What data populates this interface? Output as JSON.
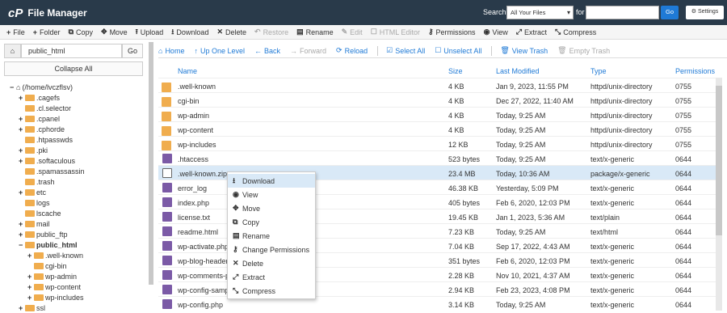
{
  "topbar": {
    "logo": "cP",
    "title": "File Manager",
    "search_label": "Search",
    "search_scope": "All Your Files",
    "for_label": "for",
    "search_value": "",
    "go_label": "Go",
    "settings_label": "Settings"
  },
  "toolbar": [
    {
      "icon": "plus-icon",
      "glyph": "+",
      "label": "File",
      "disabled": false
    },
    {
      "icon": "plus-icon",
      "glyph": "+",
      "label": "Folder",
      "disabled": false
    },
    {
      "icon": "copy-icon",
      "glyph": "⧉",
      "label": "Copy",
      "disabled": false
    },
    {
      "icon": "move-icon",
      "glyph": "✥",
      "label": "Move",
      "disabled": false
    },
    {
      "icon": "upload-icon",
      "glyph": "⭱",
      "label": "Upload",
      "disabled": false
    },
    {
      "icon": "download-icon",
      "glyph": "⭳",
      "label": "Download",
      "disabled": false
    },
    {
      "icon": "delete-icon",
      "glyph": "✕",
      "label": "Delete",
      "disabled": false
    },
    {
      "icon": "restore-icon",
      "glyph": "↶",
      "label": "Restore",
      "disabled": true
    },
    {
      "icon": "rename-icon",
      "glyph": "▤",
      "label": "Rename",
      "disabled": false
    },
    {
      "icon": "edit-icon",
      "glyph": "✎",
      "label": "Edit",
      "disabled": true
    },
    {
      "icon": "html-editor-icon",
      "glyph": "☐",
      "label": "HTML Editor",
      "disabled": true
    },
    {
      "icon": "key-icon",
      "glyph": "⚷",
      "label": "Permissions",
      "disabled": false
    },
    {
      "icon": "eye-icon",
      "glyph": "◉",
      "label": "View",
      "disabled": false
    },
    {
      "icon": "extract-icon",
      "glyph": "⤢",
      "label": "Extract",
      "disabled": false
    },
    {
      "icon": "compress-icon",
      "glyph": "⤡",
      "label": "Compress",
      "disabled": false
    }
  ],
  "sidebar": {
    "path_value": "public_html",
    "go_label": "Go",
    "collapse_label": "Collapse All",
    "tree": [
      {
        "label": "(/home/lvczflsv)",
        "level": 0,
        "toggle": "−",
        "home": true,
        "bold": false
      },
      {
        "label": ".cagefs",
        "level": 1,
        "toggle": "+",
        "bold": false
      },
      {
        "label": ".cl.selector",
        "level": 1,
        "toggle": "",
        "bold": false
      },
      {
        "label": ".cpanel",
        "level": 1,
        "toggle": "+",
        "bold": false
      },
      {
        "label": ".cphorde",
        "level": 1,
        "toggle": "+",
        "bold": false
      },
      {
        "label": ".htpasswds",
        "level": 1,
        "toggle": "",
        "bold": false
      },
      {
        "label": ".pki",
        "level": 1,
        "toggle": "+",
        "bold": false
      },
      {
        "label": ".softaculous",
        "level": 1,
        "toggle": "+",
        "bold": false
      },
      {
        "label": ".spamassassin",
        "level": 1,
        "toggle": "",
        "bold": false
      },
      {
        "label": ".trash",
        "level": 1,
        "toggle": "",
        "bold": false
      },
      {
        "label": "etc",
        "level": 1,
        "toggle": "+",
        "bold": false
      },
      {
        "label": "logs",
        "level": 1,
        "toggle": "",
        "bold": false
      },
      {
        "label": "lscache",
        "level": 1,
        "toggle": "",
        "bold": false
      },
      {
        "label": "mail",
        "level": 1,
        "toggle": "+",
        "bold": false
      },
      {
        "label": "public_ftp",
        "level": 1,
        "toggle": "+",
        "bold": false
      },
      {
        "label": "public_html",
        "level": 1,
        "toggle": "−",
        "bold": true
      },
      {
        "label": ".well-known",
        "level": 2,
        "toggle": "+",
        "bold": false
      },
      {
        "label": "cgi-bin",
        "level": 2,
        "toggle": "",
        "bold": false
      },
      {
        "label": "wp-admin",
        "level": 2,
        "toggle": "+",
        "bold": false
      },
      {
        "label": "wp-content",
        "level": 2,
        "toggle": "+",
        "bold": false
      },
      {
        "label": "wp-includes",
        "level": 2,
        "toggle": "+",
        "bold": false
      },
      {
        "label": "ssl",
        "level": 1,
        "toggle": "+",
        "bold": false
      }
    ]
  },
  "nav": [
    {
      "icon": "home-icon",
      "glyph": "⌂",
      "label": "Home",
      "disabled": false
    },
    {
      "icon": "up-level-icon",
      "glyph": "↑",
      "label": "Up One Level",
      "disabled": false
    },
    {
      "icon": "back-icon",
      "glyph": "←",
      "label": "Back",
      "disabled": false
    },
    {
      "icon": "forward-icon",
      "glyph": "→",
      "label": "Forward",
      "disabled": true
    },
    {
      "icon": "reload-icon",
      "glyph": "⟳",
      "label": "Reload",
      "disabled": false
    },
    {
      "icon": "select-all-icon",
      "glyph": "☑",
      "label": "Select All",
      "disabled": false
    },
    {
      "icon": "unselect-all-icon",
      "glyph": "☐",
      "label": "Unselect All",
      "disabled": false
    },
    {
      "icon": "trash-icon",
      "glyph": "🗑",
      "label": "View Trash",
      "disabled": false
    },
    {
      "icon": "empty-trash-icon",
      "glyph": "🗑",
      "label": "Empty Trash",
      "disabled": true
    }
  ],
  "table": {
    "headers": {
      "name": "Name",
      "size": "Size",
      "modified": "Last Modified",
      "type": "Type",
      "perms": "Permissions"
    },
    "rows": [
      {
        "kind": "folder",
        "name": ".well-known",
        "size": "4 KB",
        "modified": "Jan 9, 2023, 11:55 PM",
        "type": "httpd/unix-directory",
        "perms": "0755"
      },
      {
        "kind": "folder",
        "name": "cgi-bin",
        "size": "4 KB",
        "modified": "Dec 27, 2022, 11:40 AM",
        "type": "httpd/unix-directory",
        "perms": "0755"
      },
      {
        "kind": "folder",
        "name": "wp-admin",
        "size": "4 KB",
        "modified": "Today, 9:25 AM",
        "type": "httpd/unix-directory",
        "perms": "0755"
      },
      {
        "kind": "folder",
        "name": "wp-content",
        "size": "4 KB",
        "modified": "Today, 9:25 AM",
        "type": "httpd/unix-directory",
        "perms": "0755"
      },
      {
        "kind": "folder",
        "name": "wp-includes",
        "size": "12 KB",
        "modified": "Today, 9:25 AM",
        "type": "httpd/unix-directory",
        "perms": "0755"
      },
      {
        "kind": "file",
        "name": ".htaccess",
        "size": "523 bytes",
        "modified": "Today, 9:25 AM",
        "type": "text/x-generic",
        "perms": "0644"
      },
      {
        "kind": "zip",
        "name": ".well-known.zip",
        "size": "23.4 MB",
        "modified": "Today, 10:36 AM",
        "type": "package/x-generic",
        "perms": "0644",
        "selected": true
      },
      {
        "kind": "file",
        "name": "error_log",
        "size": "46.38 KB",
        "modified": "Yesterday, 5:09 PM",
        "type": "text/x-generic",
        "perms": "0644"
      },
      {
        "kind": "file",
        "name": "index.php",
        "size": "405 bytes",
        "modified": "Feb 6, 2020, 12:03 PM",
        "type": "text/x-generic",
        "perms": "0644"
      },
      {
        "kind": "file",
        "name": "license.txt",
        "size": "19.45 KB",
        "modified": "Jan 1, 2023, 5:36 AM",
        "type": "text/plain",
        "perms": "0644"
      },
      {
        "kind": "file",
        "name": "readme.html",
        "size": "7.23 KB",
        "modified": "Today, 9:25 AM",
        "type": "text/html",
        "perms": "0644"
      },
      {
        "kind": "file",
        "name": "wp-activate.php",
        "size": "7.04 KB",
        "modified": "Sep 17, 2022, 4:43 AM",
        "type": "text/x-generic",
        "perms": "0644"
      },
      {
        "kind": "file",
        "name": "wp-blog-header.php",
        "size": "351 bytes",
        "modified": "Feb 6, 2020, 12:03 PM",
        "type": "text/x-generic",
        "perms": "0644"
      },
      {
        "kind": "file",
        "name": "wp-comments-post.php",
        "size": "2.28 KB",
        "modified": "Nov 10, 2021, 4:37 AM",
        "type": "text/x-generic",
        "perms": "0644"
      },
      {
        "kind": "file",
        "name": "wp-config-sample.php",
        "size": "2.94 KB",
        "modified": "Feb 23, 2023, 4:08 PM",
        "type": "text/x-generic",
        "perms": "0644"
      },
      {
        "kind": "file",
        "name": "wp-config.php",
        "size": "3.14 KB",
        "modified": "Today, 9:25 AM",
        "type": "text/x-generic",
        "perms": "0644"
      }
    ]
  },
  "context_menu": [
    {
      "icon": "download-icon",
      "glyph": "⭳",
      "label": "Download",
      "highlight": true
    },
    {
      "icon": "eye-icon",
      "glyph": "◉",
      "label": "View"
    },
    {
      "icon": "move-icon",
      "glyph": "✥",
      "label": "Move"
    },
    {
      "icon": "copy-icon",
      "glyph": "⧉",
      "label": "Copy"
    },
    {
      "icon": "rename-icon",
      "glyph": "▤",
      "label": "Rename"
    },
    {
      "icon": "key-icon",
      "glyph": "⚷",
      "label": "Change Permissions"
    },
    {
      "icon": "delete-icon",
      "glyph": "✕",
      "label": "Delete"
    },
    {
      "icon": "extract-icon",
      "glyph": "⤢",
      "label": "Extract"
    },
    {
      "icon": "compress-icon",
      "glyph": "⤡",
      "label": "Compress"
    }
  ],
  "colors": {
    "topbar": "#293a4a",
    "accent": "#1f7ad6",
    "folder": "#f0ad4e",
    "file": "#7b5aa6",
    "selected_row": "#d9e9f7"
  }
}
